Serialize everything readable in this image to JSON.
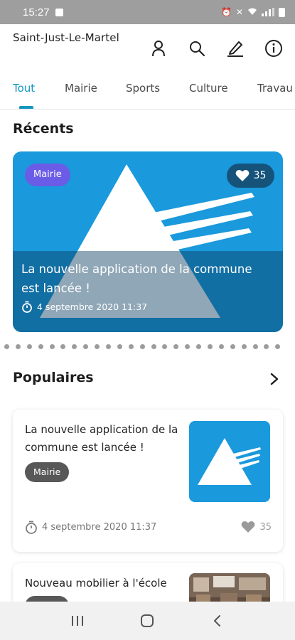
{
  "status_bar": {
    "time": "15:27",
    "icons": [
      "notification-icon",
      "alarm-icon",
      "mute-icon",
      "wifi-icon",
      "signal-icon",
      "battery-icon"
    ]
  },
  "header": {
    "title": "Saint-Just-Le-Martel",
    "icons": [
      "user-icon",
      "search-icon",
      "edit-icon",
      "info-icon"
    ]
  },
  "tabs": [
    {
      "label": "Tout",
      "active": true
    },
    {
      "label": "Mairie",
      "active": false
    },
    {
      "label": "Sports",
      "active": false
    },
    {
      "label": "Culture",
      "active": false
    },
    {
      "label": "Travau",
      "active": false
    }
  ],
  "recents": {
    "title": "Récents",
    "card": {
      "badge": "Mairie",
      "likes": "35",
      "title": "La nouvelle application de la commune est lancée !",
      "date": "4 septembre 2020 11:37"
    }
  },
  "populaires": {
    "title": "Populaires",
    "cards": [
      {
        "title": "La nouvelle application de la commune est lancée !",
        "badge": "Mairie",
        "date": "4 septembre 2020 11:37",
        "likes": "35"
      },
      {
        "title": "Nouveau mobilier à l'école"
      }
    ]
  },
  "colors": {
    "accent": "#1197c0",
    "hero_blue": "#1a99dc",
    "badge_purple": "#6b5ce7",
    "badge_grey": "#585858"
  }
}
